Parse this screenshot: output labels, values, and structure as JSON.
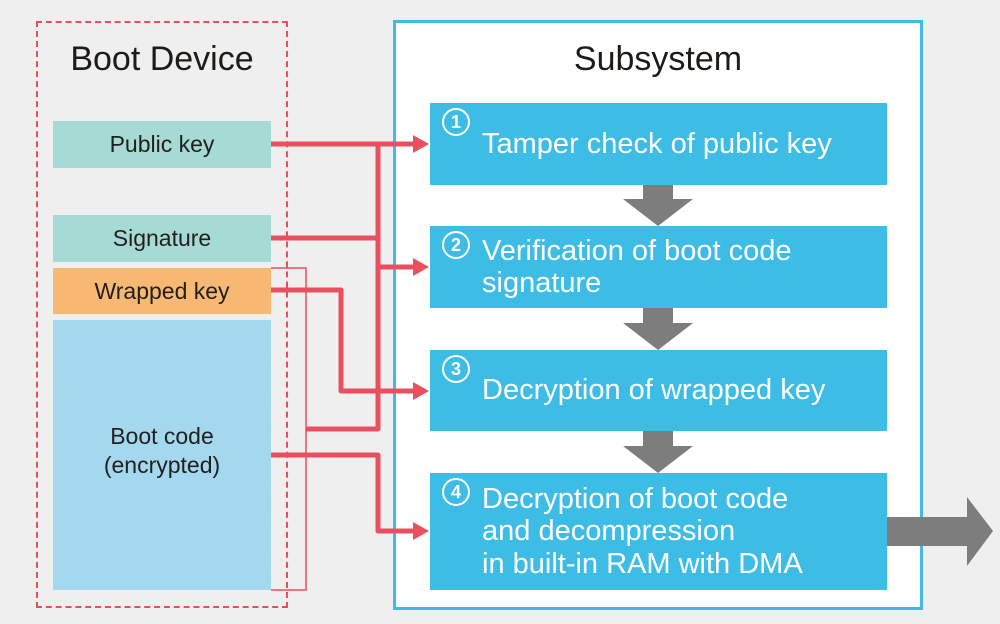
{
  "boot_device": {
    "title": "Boot Device",
    "items": [
      {
        "label": "Public key"
      },
      {
        "label": "Signature"
      },
      {
        "label": "Wrapped key"
      },
      {
        "label": "Boot code\n(encrypted)"
      }
    ]
  },
  "subsystem": {
    "title": "Subsystem",
    "steps": [
      {
        "number": "1",
        "label": "Tamper check of public key"
      },
      {
        "number": "2",
        "label": "Verification of boot code\nsignature"
      },
      {
        "number": "3",
        "label": "Decryption of wrapped key"
      },
      {
        "number": "4",
        "label": "Decryption of boot code\nand decompression\nin built-in RAM with DMA"
      }
    ]
  },
  "colors": {
    "connector": "#e8505f",
    "step_fill": "#3dbde6",
    "flow_arrow": "#7d7d7d",
    "key_fill": "#a6dad4",
    "wrapped_key_fill": "#f6b872",
    "boot_code_fill": "#a3d8ef"
  }
}
